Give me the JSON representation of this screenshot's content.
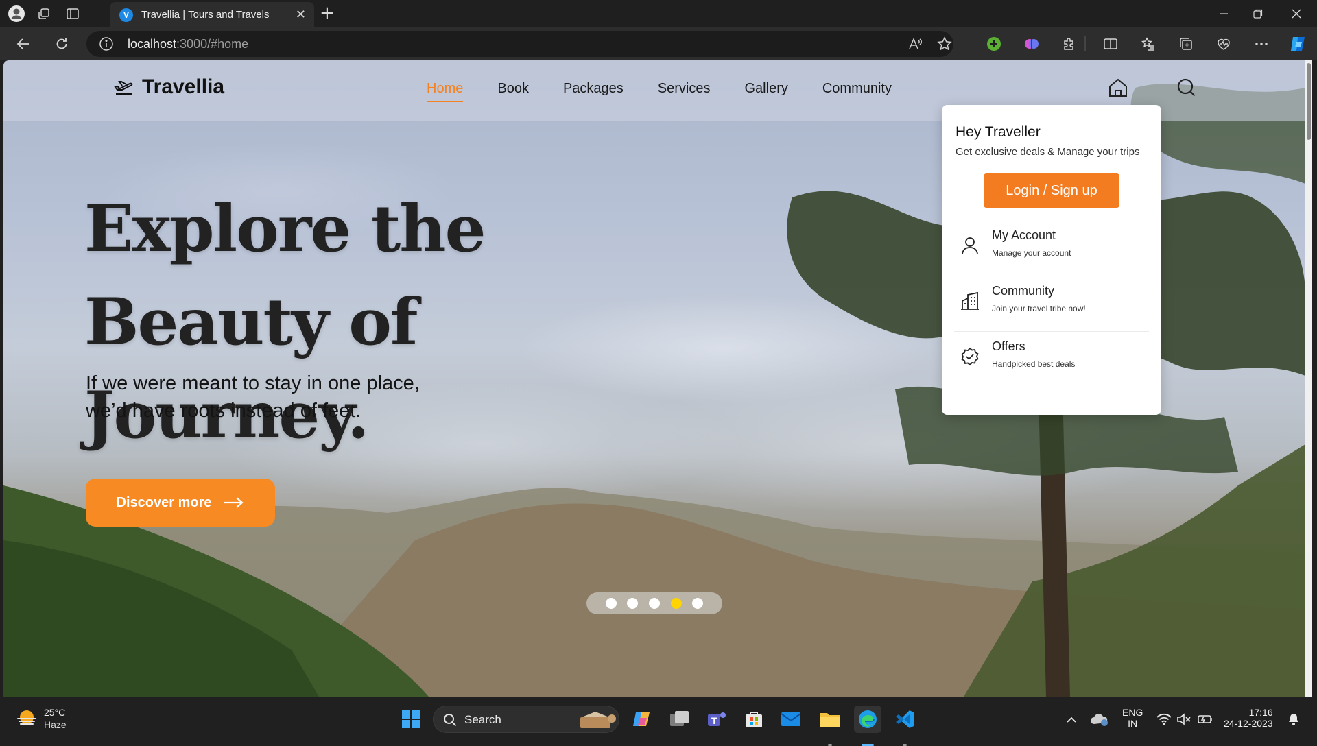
{
  "browser": {
    "tab_title": "Travellia | Tours and Travels",
    "tab_favicon_letter": "V",
    "tab_close": "✕",
    "new_tab": "+",
    "address_host": "localhost",
    "address_rest": ":3000/#home"
  },
  "site": {
    "brand": "Travellia",
    "menu": [
      "Home",
      "Book",
      "Packages",
      "Services",
      "Gallery",
      "Community"
    ],
    "active_menu": "Home",
    "accent_color": "#f58220"
  },
  "hero": {
    "title": "Explore the Beauty of Journey.",
    "subtitle_line1": "If we were meant to stay in one place,",
    "subtitle_line2": "we’d have roots instead of feet.",
    "cta_label": "Discover more",
    "slide_count": 5,
    "active_slide": 4
  },
  "dropdown": {
    "title": "Hey Traveller",
    "subtitle": "Get exclusive deals & Manage your trips",
    "login_label": "Login / Sign up",
    "items": [
      {
        "label": "My Account",
        "sub": "Manage your account",
        "icon": "user-icon"
      },
      {
        "label": "Community",
        "sub": "Join your travel tribe now!",
        "icon": "buildings-icon"
      },
      {
        "label": "Offers",
        "sub": "Handpicked best deals",
        "icon": "badge-check-icon"
      }
    ]
  },
  "taskbar": {
    "weather_temp": "25°C",
    "weather_desc": "Haze",
    "search_label": "Search",
    "lang_line1": "ENG",
    "lang_line2": "IN",
    "time": "17:16",
    "date": "24-12-2023"
  }
}
